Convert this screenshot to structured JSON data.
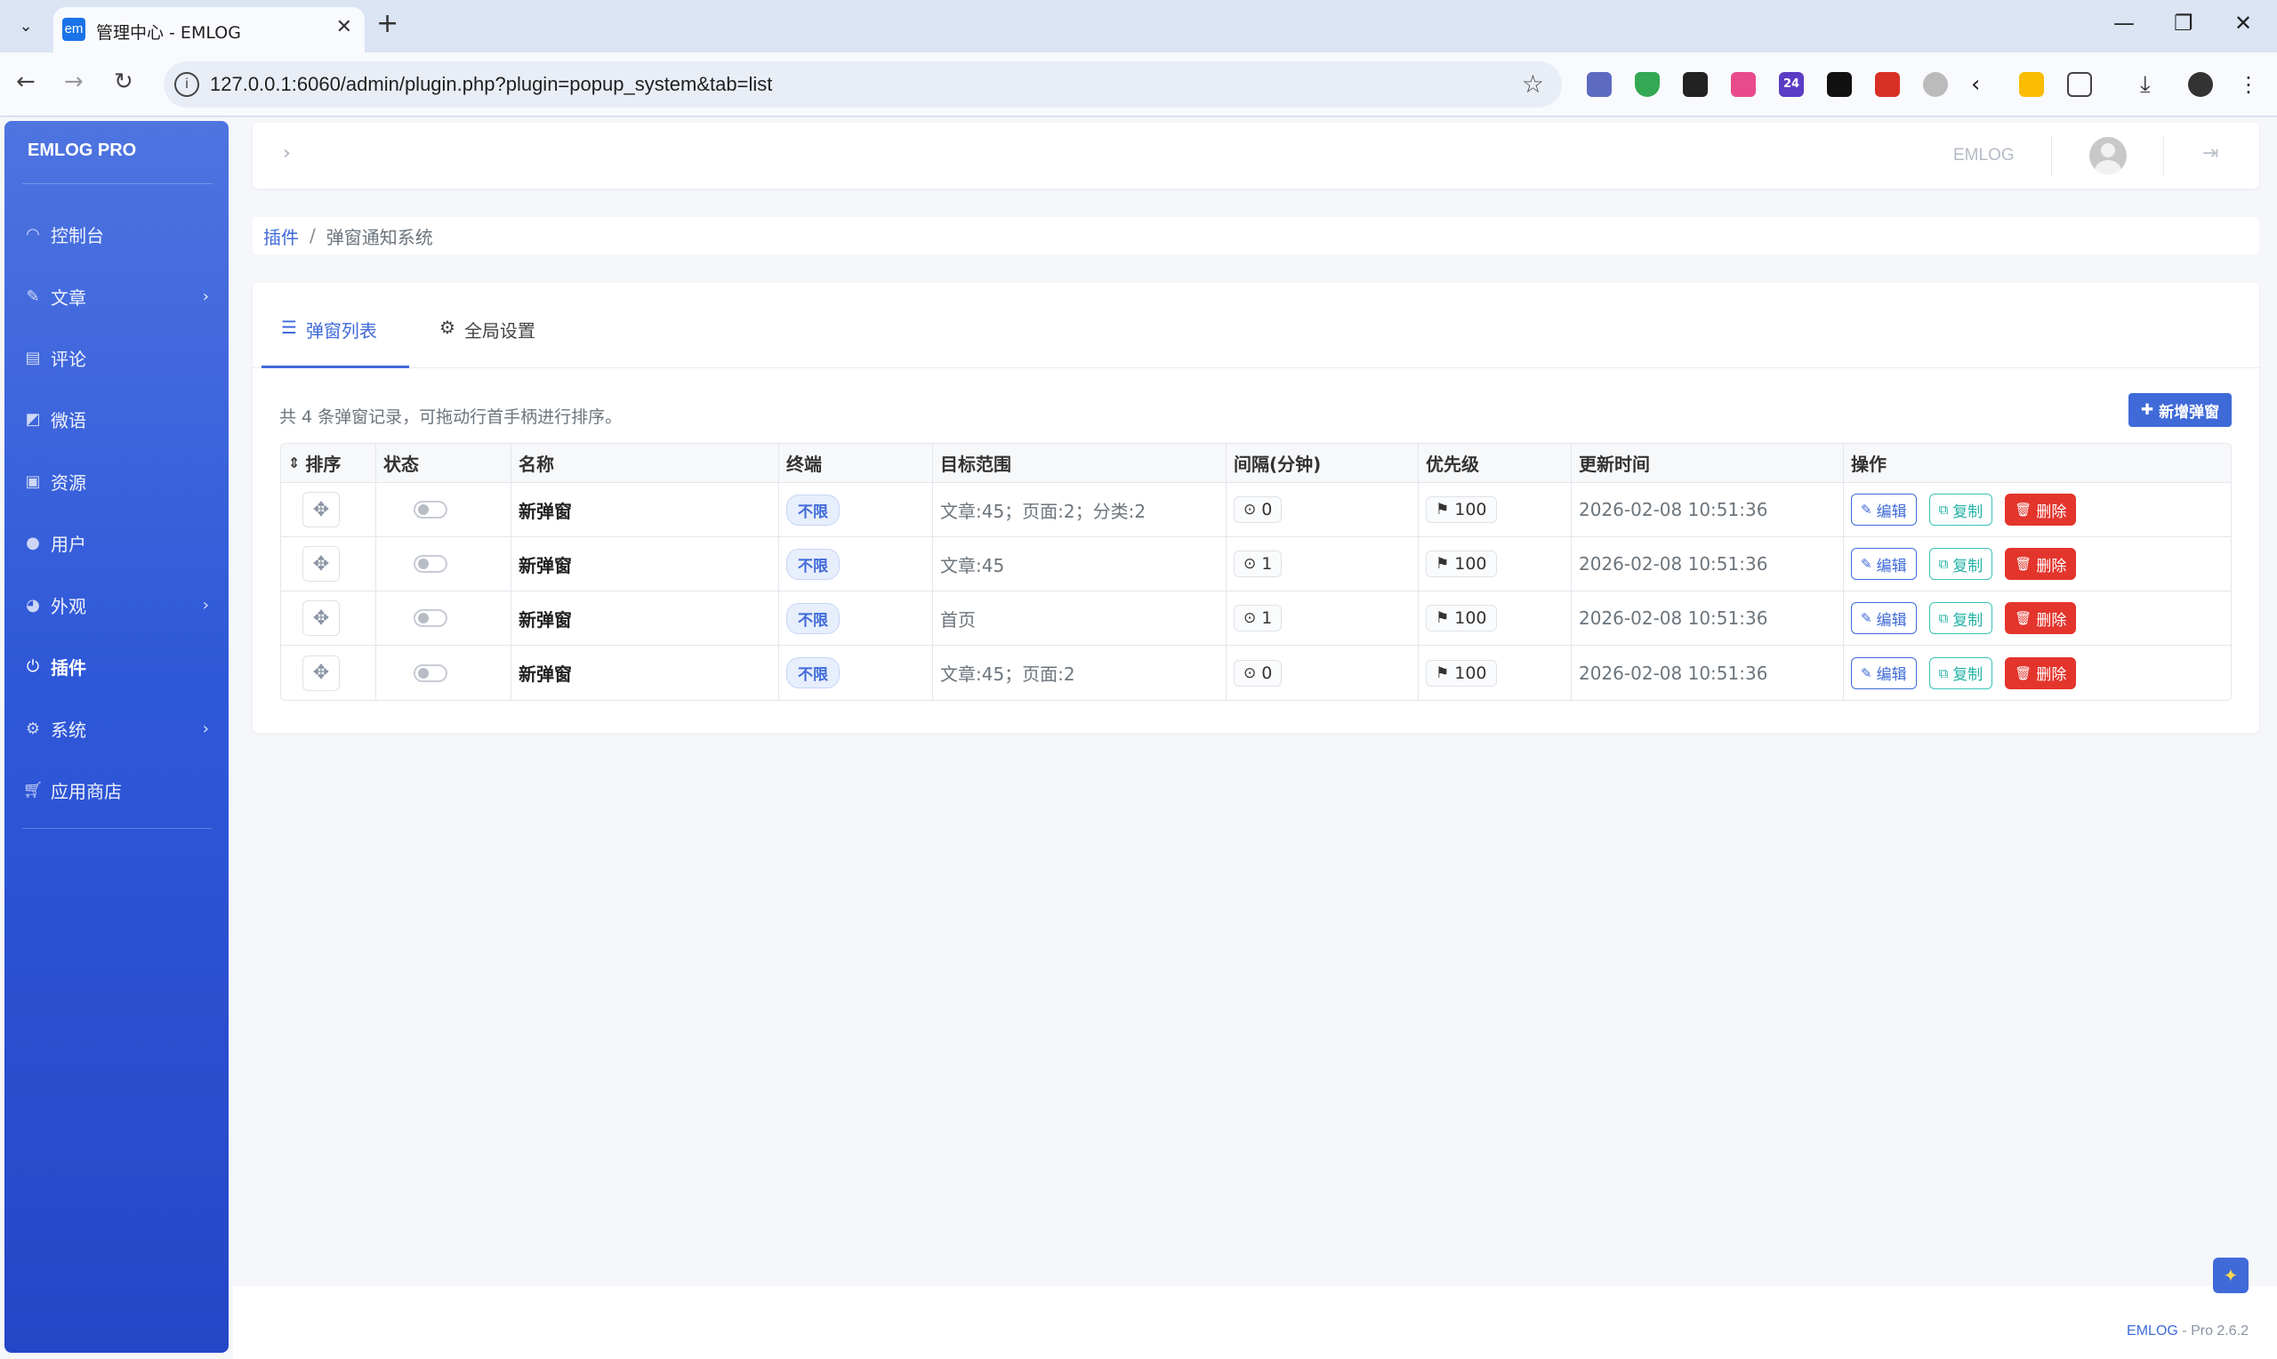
{
  "browser": {
    "tab_title": "管理中心 - EMLOG",
    "tab_favicon": "em",
    "url": "127.0.0.1:6060/admin/plugin.php?plugin=popup_system&tab=list",
    "extension_badge": "24"
  },
  "sidebar": {
    "brand": "EMLOG PRO",
    "items": [
      {
        "label": "控制台",
        "icon": "dashboard-icon",
        "chevron": false,
        "active": false
      },
      {
        "label": "文章",
        "icon": "pencil-icon",
        "chevron": true,
        "active": false
      },
      {
        "label": "评论",
        "icon": "comment-icon",
        "chevron": false,
        "active": false
      },
      {
        "label": "微语",
        "icon": "note-icon",
        "chevron": false,
        "active": false
      },
      {
        "label": "资源",
        "icon": "image-icon",
        "chevron": false,
        "active": false
      },
      {
        "label": "用户",
        "icon": "user-icon",
        "chevron": false,
        "active": false
      },
      {
        "label": "外观",
        "icon": "palette-icon",
        "chevron": true,
        "active": false
      },
      {
        "label": "插件",
        "icon": "plug-icon",
        "chevron": false,
        "active": true
      },
      {
        "label": "系统",
        "icon": "gear-icon",
        "chevron": true,
        "active": false
      },
      {
        "label": "应用商店",
        "icon": "cart-icon",
        "chevron": false,
        "active": false
      }
    ]
  },
  "topbar": {
    "site_name": "EMLOG"
  },
  "breadcrumb": {
    "parent": "插件",
    "separator": "/",
    "current": "弹窗通知系统"
  },
  "content_tabs": [
    {
      "label": "弹窗列表",
      "icon": "list-icon",
      "active": true
    },
    {
      "label": "全局设置",
      "icon": "gears-icon",
      "active": false
    }
  ],
  "summary": "共 4 条弹窗记录，可拖动行首手柄进行排序。",
  "add_button": "新增弹窗",
  "table": {
    "headers": [
      "排序",
      "状态",
      "名称",
      "终端",
      "目标范围",
      "间隔(分钟)",
      "优先级",
      "更新时间",
      "操作"
    ],
    "rows": [
      {
        "name": "新弹窗",
        "terminal": "不限",
        "target": "文章:45；页面:2；分类:2",
        "interval": "0",
        "priority": "100",
        "updated": "2026-02-08 10:51:36",
        "enabled": false
      },
      {
        "name": "新弹窗",
        "terminal": "不限",
        "target": "文章:45",
        "interval": "1",
        "priority": "100",
        "updated": "2026-02-08 10:51:36",
        "enabled": false
      },
      {
        "name": "新弹窗",
        "terminal": "不限",
        "target": "首页",
        "interval": "1",
        "priority": "100",
        "updated": "2026-02-08 10:51:36",
        "enabled": false
      },
      {
        "name": "新弹窗",
        "terminal": "不限",
        "target": "文章:45；页面:2",
        "interval": "0",
        "priority": "100",
        "updated": "2026-02-08 10:51:36",
        "enabled": false
      }
    ],
    "actions": {
      "edit": "编辑",
      "copy": "复制",
      "delete": "删除"
    }
  },
  "footer": {
    "brand": "EMLOG",
    "version": " - Pro 2.6.2"
  },
  "colors": {
    "accent": "#3f6ad8",
    "danger": "#e3352c",
    "teal": "#22b2a6",
    "sidebar_top": "#4e74e0",
    "sidebar_bottom": "#2447c8"
  }
}
